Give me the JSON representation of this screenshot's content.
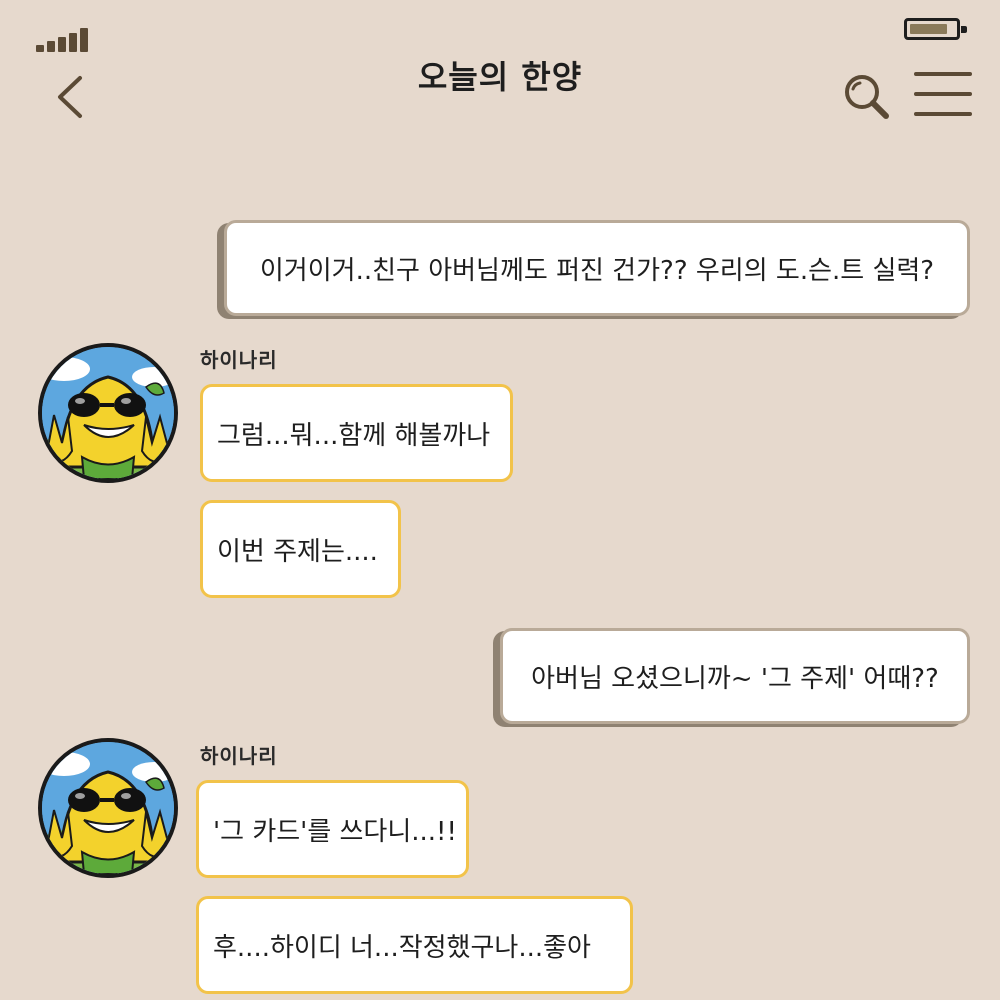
{
  "header": {
    "title": "오늘의 한양",
    "back_icon": "chevron-left-icon",
    "search_icon": "search-icon",
    "menu_icon": "hamburger-menu-icon"
  },
  "status_bar": {
    "signal_icon": "signal-bars-icon",
    "battery_icon": "battery-icon",
    "battery_level": 0.85
  },
  "messages": [
    {
      "side": "right",
      "text": "이거이거..친구 아버님께도 퍼진 건가?? 우리의 도.슨.트 실력?"
    },
    {
      "side": "left",
      "sender": "하이나리",
      "text": "그럼...뭐...함께 해볼까나"
    },
    {
      "side": "left",
      "text": "이번 주제는...."
    },
    {
      "side": "right",
      "text": "아버님 오셨으니까~ '그 주제' 어때??"
    },
    {
      "side": "left",
      "sender": "하이나리",
      "text": "'그 카드'를 쓰다니...!!"
    },
    {
      "side": "left",
      "text": "후....하이디 너...작정했구나...좋아"
    }
  ],
  "colors": {
    "background": "#e6d9cd",
    "left_bubble_border": "#f2c34a",
    "right_bubble_border": "#b9aa98",
    "right_bubble_shadow": "#8f8272",
    "icon_brown": "#5b4a35"
  }
}
